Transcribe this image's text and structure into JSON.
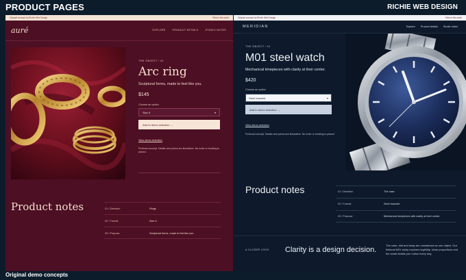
{
  "header": {
    "title": "PRODUCT PAGES",
    "brand": "RICHIE WEB DESIGN"
  },
  "footer": {
    "caption": "Original demo concepts"
  },
  "left_page": {
    "notice": {
      "text": "Original concept by Richie Web Design",
      "right": "Return this week"
    },
    "logo": "auré",
    "nav": [
      "EXPLORE",
      "PRODUCT DETAILS",
      "STUDIO NOTES"
    ],
    "eyebrow": "THE OBJECT / 01",
    "title": "Arc ring",
    "tagline": "Sculptural forms, made to feel like you.",
    "price": "$145",
    "option_label": "Choose an option",
    "option_value": "Size 6",
    "cta": "Add to demo selection →",
    "link": "View demo selection",
    "disclaimer": "Fictional concept. Details and prices are illustrative. No order or booking is placed.",
    "notes_title": "Product notes",
    "notes": [
      {
        "key": "01 / Direction",
        "value": "Rings"
      },
      {
        "key": "02 / Format",
        "value": "Size 6"
      },
      {
        "key": "03 / Purpose",
        "value": "Sculptural forms, made to feel like you."
      }
    ],
    "colors": {
      "background": "#4d0f24",
      "accent": "#f7e6d8"
    }
  },
  "right_page": {
    "notice": {
      "text": "Original concept by Richie Web Design",
      "right": "Return this week"
    },
    "logo": "MERIDIAN",
    "nav": [
      "Explore",
      "Product details",
      "Studio notes"
    ],
    "eyebrow": "THE OBJECT / 01",
    "title": "M01 steel watch",
    "tagline": "Mechanical timepieces with clarity at their center.",
    "price": "$420",
    "option_label": "Choose an option",
    "option_value": "Steel bracelet",
    "cta": "Add to demo selection →",
    "link": "View demo selection",
    "disclaimer": "Fictional concept. Details and prices are illustrative. No order or booking is placed.",
    "notes_title": "Product notes",
    "notes": [
      {
        "key": "01 / Direction",
        "value": "The case"
      },
      {
        "key": "02 / Format",
        "value": "Steel bracelet"
      },
      {
        "key": "03 / Purpose",
        "value": "Mechanical timepieces with clarity at their center."
      }
    ],
    "closer": {
      "eyebrow": "A CLOSER LOOK",
      "headline": "Clarity is a design decision.",
      "body": "The case, dial and strap are considered as one object. Our fictional M01 study explores legibility, clean proportions and the small details you notice every day."
    },
    "colors": {
      "background": "#0e1a2b",
      "accent": "#c7d1e0"
    }
  }
}
